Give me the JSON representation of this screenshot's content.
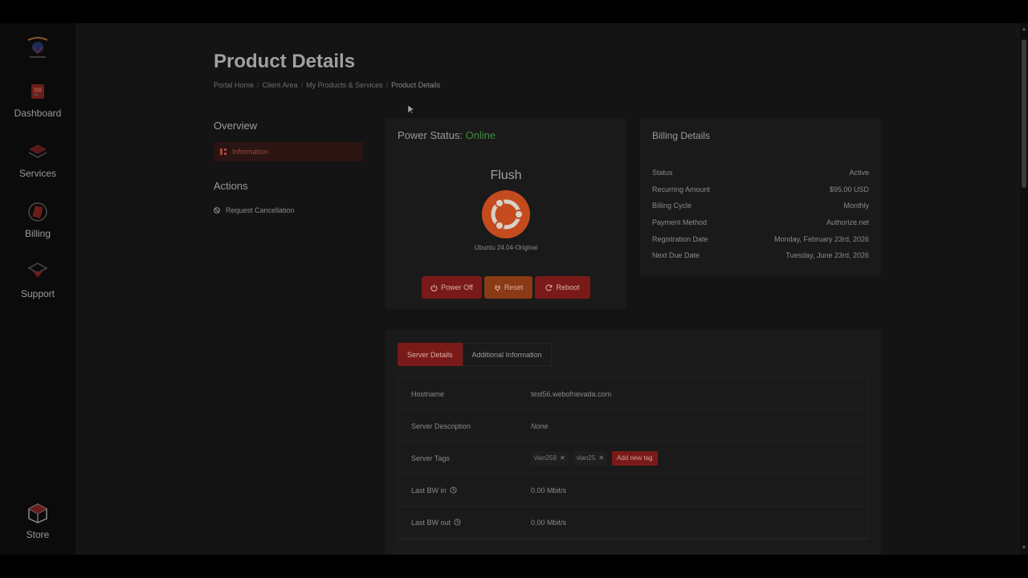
{
  "sidebar": {
    "items": [
      {
        "label": "Dashboard",
        "icon": "dashboard-icon"
      },
      {
        "label": "Services",
        "icon": "services-icon"
      },
      {
        "label": "Billing",
        "icon": "billing-icon"
      },
      {
        "label": "Support",
        "icon": "support-icon"
      },
      {
        "label": "Store",
        "icon": "store-icon"
      }
    ]
  },
  "page": {
    "title": "Product Details",
    "breadcrumb": [
      "Portal Home",
      "Client Area",
      "My Products & Services",
      "Product Details"
    ]
  },
  "side_menu": {
    "overview_heading": "Overview",
    "information_label": "Information",
    "actions_heading": "Actions",
    "request_cancellation_label": "Request Cancellation"
  },
  "power": {
    "status_label": "Power Status:",
    "status_value": "Online",
    "server_name": "Flush",
    "os_name": "Ubuntu 24.04-Original",
    "buttons": {
      "power_off": "Power Off",
      "reset": "Reset",
      "reboot": "Reboot"
    }
  },
  "billing": {
    "title": "Billing Details",
    "rows": [
      {
        "label": "Status",
        "value": "Active"
      },
      {
        "label": "Recurring Amount",
        "value": "$95.00 USD"
      },
      {
        "label": "Billing Cycle",
        "value": "Monthly"
      },
      {
        "label": "Payment Method",
        "value": "Authorize.net"
      },
      {
        "label": "Registration Date",
        "value": "Monday, February 23rd, 2026"
      },
      {
        "label": "Next Due Date",
        "value": "Tuesday, June 23rd, 2026"
      }
    ]
  },
  "server": {
    "tabs": [
      "Server Details",
      "Additional Information"
    ],
    "hostname_label": "Hostname",
    "hostname_value": "test56.webofnevada.com",
    "description_label": "Server Description",
    "description_value": "None",
    "tags_label": "Server Tags",
    "tags": [
      "vlan258",
      "vlan25"
    ],
    "add_tag_label": "Add new tag",
    "bw_in_label": "Last BW in",
    "bw_in_value": "0.00 Mbit/s",
    "bw_out_label": "Last BW out",
    "bw_out_value": "0.00 Mbit/s"
  },
  "colors": {
    "accent": "#7a1a18",
    "online": "#3f8a3f",
    "reset": "#8a3a14",
    "os_logo": "#c44b1e"
  }
}
